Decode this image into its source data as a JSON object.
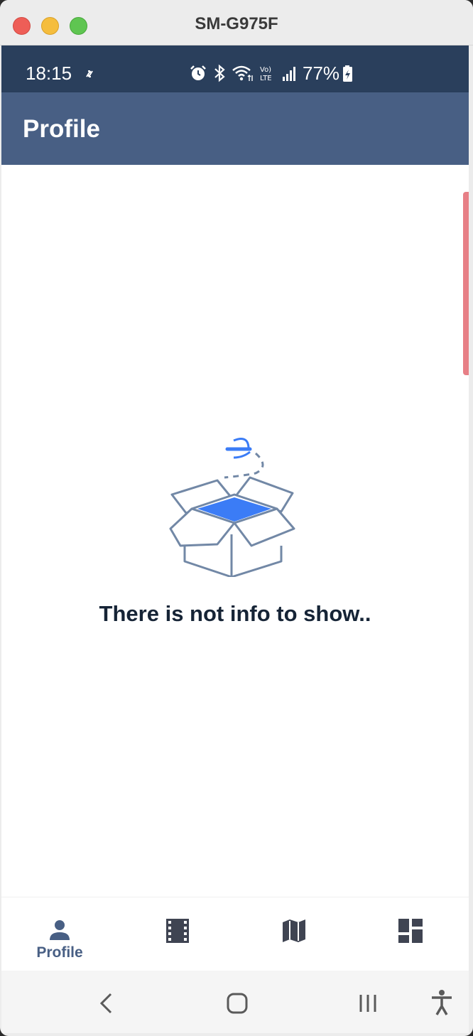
{
  "window": {
    "title": "SM-G975F"
  },
  "status_bar": {
    "time": "18:15",
    "battery": "77%"
  },
  "app_bar": {
    "title": "Profile"
  },
  "empty_state": {
    "message": "There is not info to show.."
  },
  "bottom_nav": {
    "items": [
      {
        "label": "Profile",
        "icon": "person-icon",
        "active": true
      },
      {
        "label": "",
        "icon": "film-icon",
        "active": false
      },
      {
        "label": "",
        "icon": "map-icon",
        "active": false
      },
      {
        "label": "",
        "icon": "dashboard-icon",
        "active": false
      }
    ]
  },
  "system_nav": {
    "icons": [
      "back-icon",
      "home-icon",
      "recents-icon",
      "accessibility-icon"
    ]
  },
  "colors": {
    "status_bar": "#2a3f5c",
    "app_bar": "#485f84",
    "accent": "#3b7cf6",
    "text_dark": "#162436"
  }
}
